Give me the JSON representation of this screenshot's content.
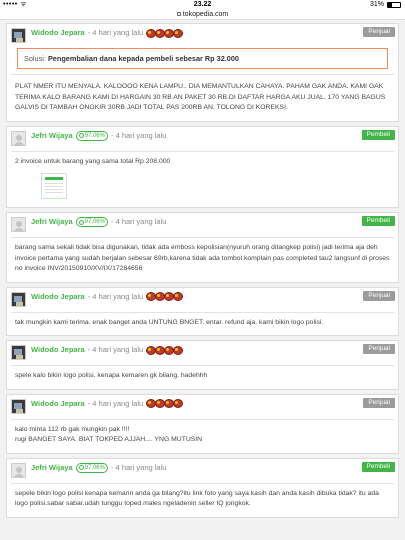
{
  "status_bar": {
    "left": "••••• ᯤ",
    "time": "23.22",
    "battery": "31%"
  },
  "url_bar": {
    "domain": "tokopedia.com"
  },
  "comments": [
    {
      "name": "Widodo Jepara",
      "time": "- 4 hari yang lalu",
      "role": "Penjual",
      "medals": 4,
      "solution_label": "Solusi:",
      "solution_text": "Pengembalian dana kepada pembeli sebesar Rp 32.000",
      "text": "PLAT NMER ITU MENYALA. KALOOOO KENA LAMPU.. DIA MEMANTULKAN CAHAYA. PAHAM GAK ANDA. KAMI GAK TERIMA KALO BARANG KAMI DI HARGAIN 30 RB AN PAKET 30 RB.DI DAFTAR HARGA AKU JUAL, 170 YANG BAGUS GALVIS DI TAMBAH ONGKIR 30RB JADI TOTAL PAS 200RB AN. TOLONG DI KOREKSI."
    },
    {
      "name": "Jefri Wijaya",
      "reputation": "97,06%",
      "time": "- 4 hari yang lalu",
      "role": "Pembeli",
      "text": "2 invoice untuk barang yang sama total Rp 208.000"
    },
    {
      "name": "Jefri Wijaya",
      "reputation": "97,06%",
      "time": "- 4 hari yang lalu",
      "role": "Pembeli",
      "text": "barang sama sekali tidak bisa digunakan, tidak ada emboss kepolisian(nyuruh orang ditangkep polisi) jadi terima aja deh invoice pertama yang sudah berjalan sebesar 69rb,karena tidak ada tombol komplain pas completed tau2 langsunf di proses no invoice INV/20150910/XV/IX/17284656"
    },
    {
      "name": "Widodo Jepara",
      "time": "- 4 hari yang lalu",
      "role": "Penjual",
      "medals": 4,
      "text": "tak mungkin kami terima. enak banget anda UNTUNG BNGET. entar. refund aja. kami bikin logo polisi."
    },
    {
      "name": "Widodo Jepara",
      "time": "- 4 hari yang lalu",
      "role": "Penjual",
      "medals": 4,
      "text": "spele kalo bikin logo polisi. kenapa kemaren gk bilang. hadehhh"
    },
    {
      "name": "Widodo Jepara",
      "time": "- 4 hari yang lalu",
      "role": "Penjual",
      "medals": 4,
      "text_line1": "kalo minta 112 rb gak mungkin pak !!!!",
      "text_line2": "rugi BANGET SAYA. BIAT TOKPED AJJAH.... YNG MUTUSIN"
    },
    {
      "name": "Jefri Wijaya",
      "reputation": "97,06%",
      "time": "- 4 hari yang lalu",
      "role": "Pembeli",
      "text": "sepele bikin logo polisi kenapa kemarin anda ga bilang?itu link foto yang saya kasih dan anda kasih dibuka tidak? itu ada logo polisi.sabar sabar,udah tunggu toped males ngeladenin seller IQ jongkok."
    }
  ]
}
